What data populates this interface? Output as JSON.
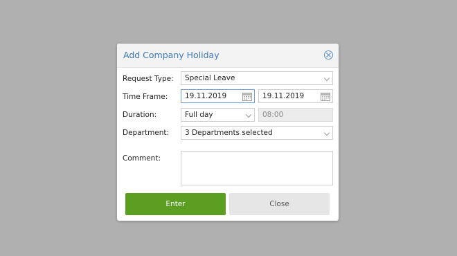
{
  "dialog": {
    "title": "Add Company Holiday",
    "close_icon": "close-icon"
  },
  "form": {
    "request_type": {
      "label": "Request Type:",
      "value": "Special Leave"
    },
    "time_frame": {
      "label": "Time Frame:",
      "from": "19.11.2019",
      "to": "19.11.2019"
    },
    "duration": {
      "label": "Duration:",
      "value": "Full day",
      "time": "08:00"
    },
    "department": {
      "label": "Department:",
      "value": "3 Departments selected"
    },
    "comment": {
      "label": "Comment:",
      "value": ""
    }
  },
  "buttons": {
    "enter": "Enter",
    "close": "Close"
  },
  "colors": {
    "title": "#3a78b8",
    "enter_button": "#5c9e21",
    "close_button": "#e6e6e6",
    "overlay": "#b0b0b0"
  }
}
